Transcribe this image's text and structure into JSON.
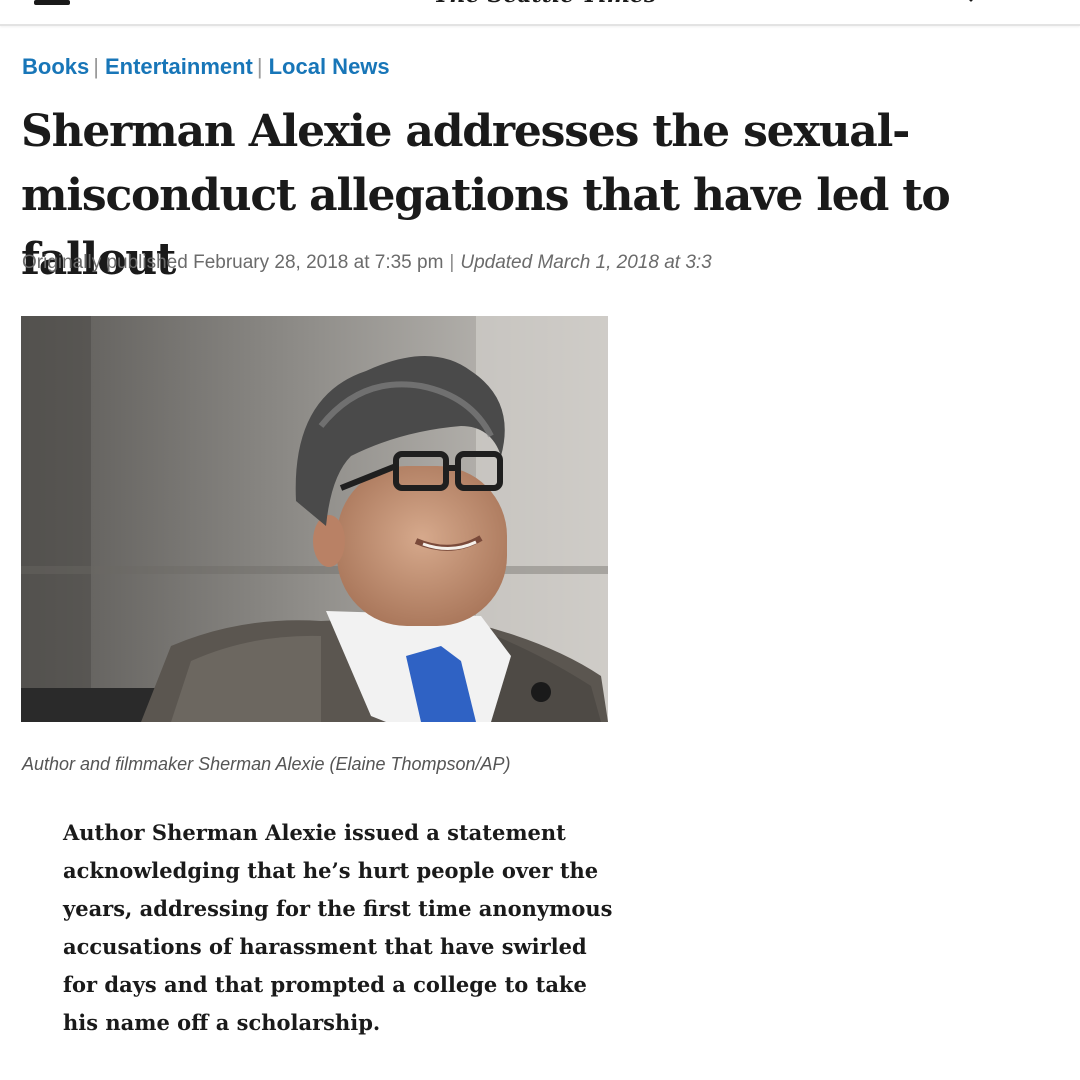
{
  "header": {
    "masthead": "The Seattle Times",
    "menu_icon": "hamburger-menu-icon",
    "search_icon": "search-icon"
  },
  "sections": [
    "Books",
    "Entertainment",
    "Local News"
  ],
  "article": {
    "headline": "Sherman Alexie addresses the sexual-misconduct allegations that have led to fallout",
    "published": "Originally published February 28, 2018 at 7:35 pm",
    "updated": "Updated March 1, 2018 at 3:3",
    "photo_alt": "Author and filmmaker Sherman Alexie",
    "caption": "Author and filmmaker Sherman Alexie (Elaine Thompson/AP)",
    "summary": "Author Sherman Alexie issued a statement acknowledging that he’s hurt people over the years, addressing for the first time anonymous accusations of harassment that have swirled for days and that prompted a college to take his name off a scholarship."
  },
  "colors": {
    "section_link": "#1876b8",
    "text": "#1a1a1a",
    "meta": "#6b6b6b"
  }
}
